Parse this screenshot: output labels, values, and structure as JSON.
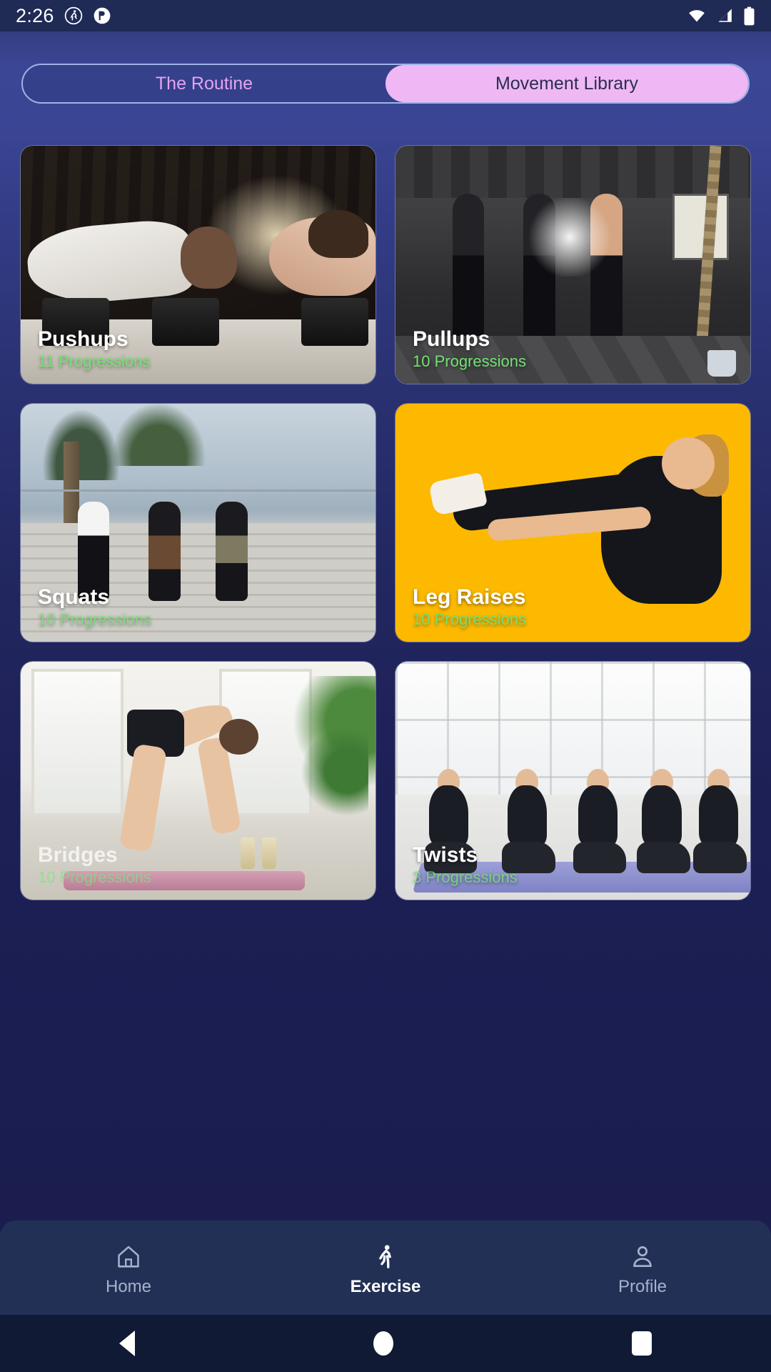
{
  "status_bar": {
    "time": "2:26",
    "left_icons": [
      "directions-run-icon",
      "do-not-disturb-icon"
    ],
    "right_icons": [
      "wifi-icon",
      "cellular-signal-icon",
      "battery-icon"
    ]
  },
  "tabs": {
    "items": [
      {
        "label": "The Routine",
        "active": false
      },
      {
        "label": "Movement Library",
        "active": true
      }
    ],
    "active_bg": "#efb8f5",
    "inactive_text": "#e3a4f2",
    "border": "#9fb3e8"
  },
  "library": {
    "cards": [
      {
        "title": "Pushups",
        "progressions": "11 Progressions",
        "art": "pushups"
      },
      {
        "title": "Pullups",
        "progressions": "10 Progressions",
        "art": "pullups"
      },
      {
        "title": "Squats",
        "progressions": "10 Progressions",
        "art": "squats"
      },
      {
        "title": "Leg Raises",
        "progressions": "10 Progressions",
        "art": "legraises"
      },
      {
        "title": "Bridges",
        "progressions": "10 Progressions",
        "art": "bridges"
      },
      {
        "title": "Twists",
        "progressions": "3 Progressions",
        "art": "twists"
      }
    ],
    "title_color": "#ffffff",
    "progression_color": "#72e272",
    "accent_yellow": "#fcb900"
  },
  "bottom_nav": {
    "items": [
      {
        "label": "Home",
        "icon": "home-icon",
        "active": false
      },
      {
        "label": "Exercise",
        "icon": "running-person-icon",
        "active": true
      },
      {
        "label": "Profile",
        "icon": "person-icon",
        "active": false
      }
    ],
    "background": "#223056"
  },
  "system_nav": {
    "back": "back-triangle-icon",
    "home": "home-circle-icon",
    "recents": "recents-square-icon"
  },
  "theme": {
    "background_top": "#3b4795",
    "background_bottom": "#191b4b",
    "status_bar_bg": "#1f2a55"
  }
}
